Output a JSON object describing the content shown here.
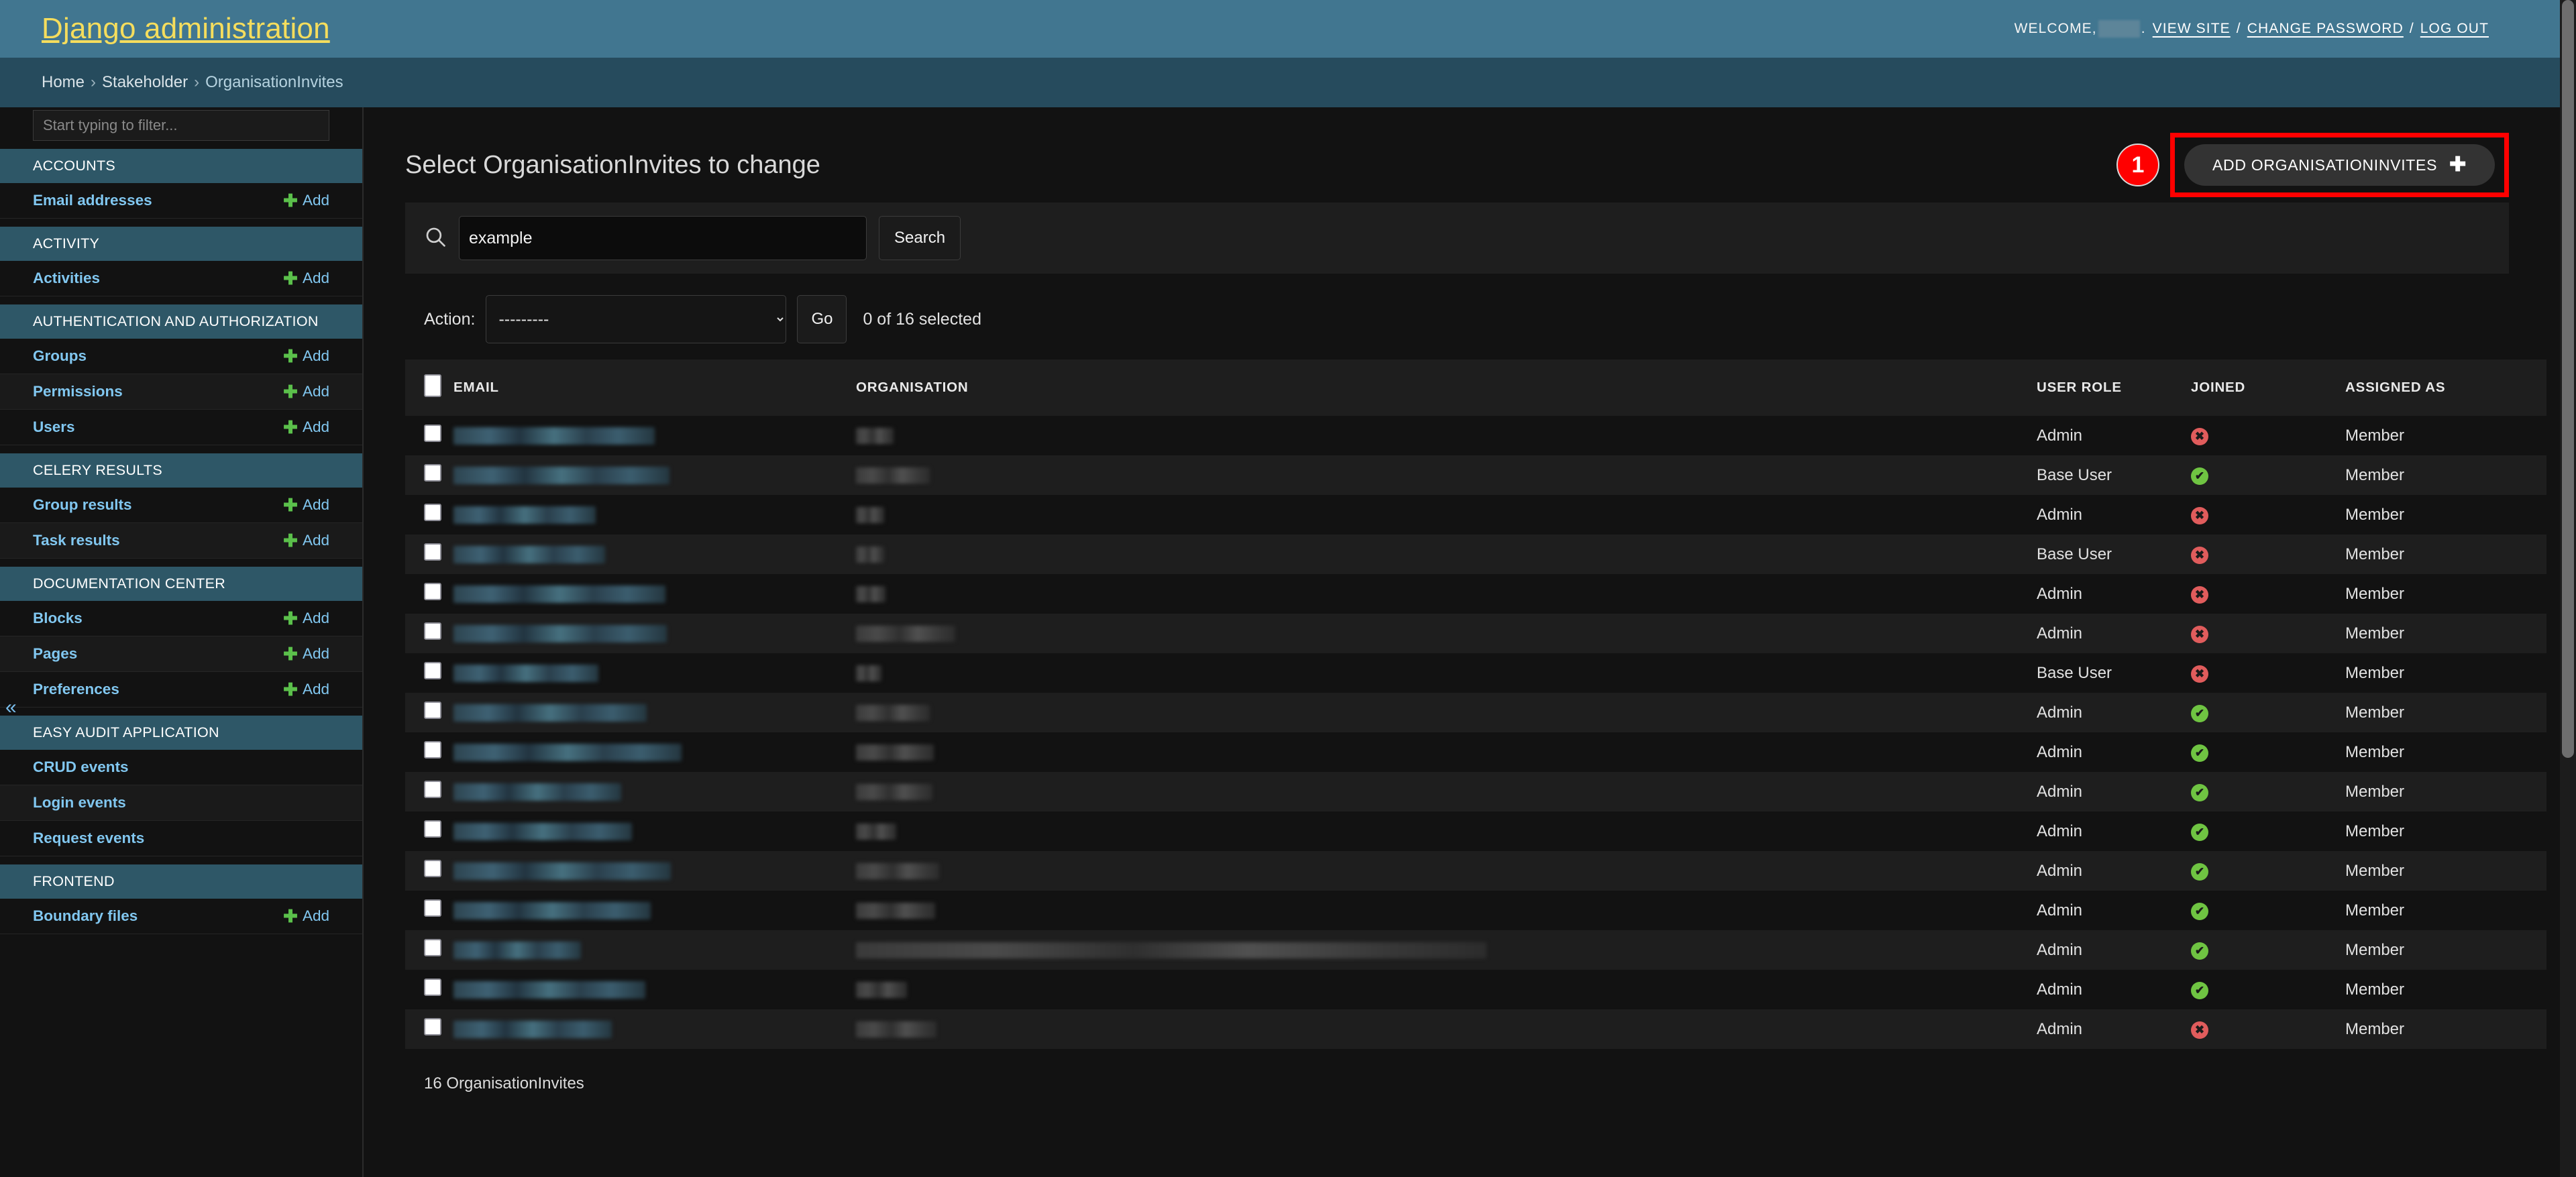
{
  "header": {
    "site_title": "Django administration",
    "welcome_prefix": "WELCOME,",
    "welcome_suffix": ".",
    "view_site": "VIEW SITE",
    "change_password": "CHANGE PASSWORD",
    "log_out": "LOG OUT",
    "separator": "/",
    "brand_color": "#417690",
    "title_color": "#f5dd5d"
  },
  "breadcrumbs": {
    "home": "Home",
    "app": "Stakeholder",
    "current": "OrganisationInvites",
    "separator": "›"
  },
  "sidebar": {
    "filter_placeholder": "Start typing to filter...",
    "collapse_glyph": "«",
    "add_label": "Add",
    "apps": [
      {
        "caption": "ACCOUNTS",
        "models": [
          {
            "label": "Email addresses",
            "addable": true
          }
        ]
      },
      {
        "caption": "ACTIVITY",
        "models": [
          {
            "label": "Activities",
            "addable": true
          }
        ]
      },
      {
        "caption": "AUTHENTICATION AND AUTHORIZATION",
        "models": [
          {
            "label": "Groups",
            "addable": true
          },
          {
            "label": "Permissions",
            "addable": true
          },
          {
            "label": "Users",
            "addable": true
          }
        ]
      },
      {
        "caption": "CELERY RESULTS",
        "models": [
          {
            "label": "Group results",
            "addable": true
          },
          {
            "label": "Task results",
            "addable": true
          }
        ]
      },
      {
        "caption": "DOCUMENTATION CENTER",
        "models": [
          {
            "label": "Blocks",
            "addable": true
          },
          {
            "label": "Pages",
            "addable": true
          },
          {
            "label": "Preferences",
            "addable": true
          }
        ]
      },
      {
        "caption": "EASY AUDIT APPLICATION",
        "models": [
          {
            "label": "CRUD events",
            "addable": false
          },
          {
            "label": "Login events",
            "addable": false
          },
          {
            "label": "Request events",
            "addable": false
          }
        ]
      },
      {
        "caption": "FRONTEND",
        "models": [
          {
            "label": "Boundary files",
            "addable": true
          }
        ]
      }
    ]
  },
  "main": {
    "page_title": "Select OrganisationInvites to change",
    "add_button_label": "ADD ORGANISATIONINVITES",
    "add_button_plus": "✚",
    "step_badge": "1",
    "step_badge_color": "#ff0000",
    "highlight_color": "#ff0000",
    "search": {
      "value": "example",
      "placeholder": "",
      "submit_label": "Search",
      "icon": "search-icon"
    },
    "actions": {
      "label": "Action:",
      "selected": "---------",
      "options": [
        "---------"
      ],
      "go_label": "Go",
      "counter": "0 of 16 selected"
    },
    "table": {
      "columns": [
        "EMAIL",
        "ORGANISATION",
        "USER ROLE",
        "JOINED",
        "ASSIGNED AS"
      ],
      "rows": [
        {
          "email_w": 300,
          "org_w": 56,
          "role": "Admin",
          "joined": false,
          "assigned": "Member"
        },
        {
          "email_w": 322,
          "org_w": 110,
          "role": "Base User",
          "joined": true,
          "assigned": "Member"
        },
        {
          "email_w": 212,
          "org_w": 42,
          "role": "Admin",
          "joined": false,
          "assigned": "Member"
        },
        {
          "email_w": 226,
          "org_w": 42,
          "role": "Base User",
          "joined": false,
          "assigned": "Member"
        },
        {
          "email_w": 316,
          "org_w": 44,
          "role": "Admin",
          "joined": false,
          "assigned": "Member"
        },
        {
          "email_w": 318,
          "org_w": 148,
          "role": "Admin",
          "joined": false,
          "assigned": "Member"
        },
        {
          "email_w": 216,
          "org_w": 38,
          "role": "Base User",
          "joined": false,
          "assigned": "Member"
        },
        {
          "email_w": 288,
          "org_w": 110,
          "role": "Admin",
          "joined": true,
          "assigned": "Member"
        },
        {
          "email_w": 340,
          "org_w": 116,
          "role": "Admin",
          "joined": true,
          "assigned": "Member"
        },
        {
          "email_w": 250,
          "org_w": 114,
          "role": "Admin",
          "joined": true,
          "assigned": "Member"
        },
        {
          "email_w": 266,
          "org_w": 60,
          "role": "Admin",
          "joined": true,
          "assigned": "Member"
        },
        {
          "email_w": 324,
          "org_w": 124,
          "role": "Admin",
          "joined": true,
          "assigned": "Member"
        },
        {
          "email_w": 294,
          "org_w": 118,
          "role": "Admin",
          "joined": true,
          "assigned": "Member"
        },
        {
          "email_w": 190,
          "org_w": 940,
          "role": "Admin",
          "joined": true,
          "assigned": "Member"
        },
        {
          "email_w": 286,
          "org_w": 76,
          "role": "Admin",
          "joined": true,
          "assigned": "Member"
        },
        {
          "email_w": 236,
          "org_w": 120,
          "role": "Admin",
          "joined": false,
          "assigned": "Member"
        }
      ],
      "joined_yes_glyph": "✔",
      "joined_no_glyph": "✖",
      "joined_yes_color": "#6fc442",
      "joined_no_color": "#e05c5c"
    },
    "result_count": "16 OrganisationInvites"
  }
}
